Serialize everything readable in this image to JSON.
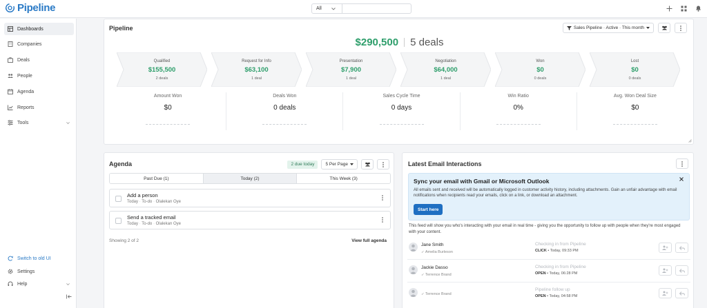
{
  "app": {
    "name": "Pipeline"
  },
  "search": {
    "scope": "All",
    "placeholder": ""
  },
  "sidebar": {
    "items": [
      {
        "label": "Dashboards"
      },
      {
        "label": "Companies"
      },
      {
        "label": "Deals"
      },
      {
        "label": "People"
      },
      {
        "label": "Agenda"
      },
      {
        "label": "Reports"
      },
      {
        "label": "Tools"
      }
    ],
    "bottom": [
      {
        "label": "Switch to old UI"
      },
      {
        "label": "Settings"
      },
      {
        "label": "Help"
      }
    ]
  },
  "pipeline": {
    "title": "Pipeline",
    "filter_label": "Sales Pipeline · Active · This month",
    "total_amount": "$290,500",
    "total_deals": "5 deals",
    "stages": [
      {
        "name": "Qualified",
        "value": "$155,500",
        "count": "2 deals"
      },
      {
        "name": "Request for Info",
        "value": "$63,100",
        "count": "1 deal"
      },
      {
        "name": "Presentation",
        "value": "$7,900",
        "count": "1 deal"
      },
      {
        "name": "Negotiation",
        "value": "$64,000",
        "count": "1 deal"
      },
      {
        "name": "Won",
        "value": "$0",
        "count": "0 deals"
      },
      {
        "name": "Lost",
        "value": "$0",
        "count": "0 deals"
      }
    ],
    "metrics": [
      {
        "label": "Amount Won",
        "value": "$0"
      },
      {
        "label": "Deals Won",
        "value": "0 deals"
      },
      {
        "label": "Sales Cycle Time",
        "value": "0 days"
      },
      {
        "label": "Win Ratio",
        "value": "0%"
      },
      {
        "label": "Avg. Won Deal Size",
        "value": "$0"
      }
    ]
  },
  "agenda": {
    "title": "Agenda",
    "due_badge": "2 due today",
    "per_page": "5 Per Page",
    "tabs": [
      {
        "label": "Past Due (1)"
      },
      {
        "label": "Today (2)"
      },
      {
        "label": "This Week (3)"
      }
    ],
    "tasks": [
      {
        "title": "Add a person",
        "date": "Today",
        "type": "To-do",
        "owner": "Olalekan Oye"
      },
      {
        "title": "Send a tracked email",
        "date": "Today",
        "type": "To-do",
        "owner": "Olalekan Oye"
      }
    ],
    "showing": "Showing 2 of 2",
    "view_full": "View full agenda"
  },
  "email": {
    "title": "Latest Email Interactions",
    "sync_title": "Sync your email with Gmail or Microsoft Outlook",
    "sync_desc": "All emails sent and received will be automatically logged in customer activity history, including attachments. Gain an unfair advantage with email notifications when recipients read your emails, click on a link, or download an attachment.",
    "start_here": "Start here",
    "feed_desc": "This feed will show you who's interacting with your email in real time - giving you the opportunity to follow up with people when they're most engaged with your content.",
    "interactions": [
      {
        "name": "Jane Smith",
        "sub": "Amelia Burleson",
        "subject": "Checking in from Pipeline",
        "action": "CLICK",
        "time": "• Today, 09:33 PM"
      },
      {
        "name": "Jackie Dasso",
        "sub": "Terrence Brand",
        "subject": "Checking in from Pipeline",
        "action": "OPEN",
        "time": "• Today, 06:28 PM"
      },
      {
        "name": "",
        "sub": "Terrence Brand",
        "subject": "Pipeline follow up",
        "action": "OPEN",
        "time": "• Today, 04:58 PM"
      }
    ]
  },
  "colors": {
    "brand": "#2a7ac6",
    "money": "#2e9e6b",
    "button_primary": "#1f6fc2",
    "sync_bg": "#e3f1fb"
  },
  "icons": {
    "top": [
      "plus-icon",
      "grid-icon",
      "bell-icon"
    ]
  }
}
